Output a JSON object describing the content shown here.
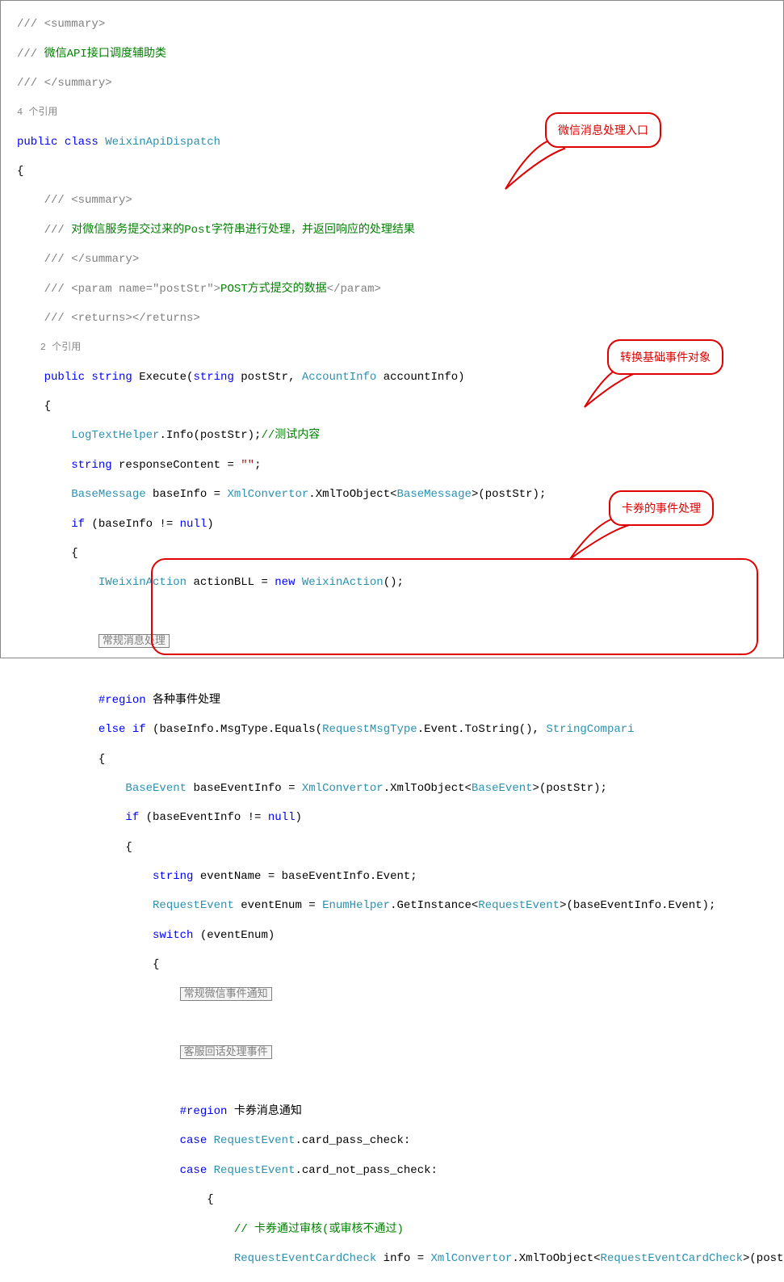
{
  "code": {
    "l01": "/// <summary>",
    "l02a": "/// ",
    "l02b": "微信API接口调度辅助类",
    "l03": "/// </summary>",
    "l04": "4 个引用",
    "l05a": "public",
    "l05b": " class",
    "l05c": " WeixinApiDispatch",
    "l06": "{",
    "l07": "    /// <summary>",
    "l08a": "    /// ",
    "l08b": "对微信服务提交过来的Post字符串进行处理，并返回响应的处理结果",
    "l09": "    /// </summary>",
    "l10a": "    /// <param name=\"postStr\">",
    "l10b": "POST方式提交的数据",
    "l10c": "</param>",
    "l11": "    /// <returns></returns>",
    "l12": "    2 个引用",
    "l13a": "    public",
    "l13b": " string",
    "l13c": " Execute(",
    "l13d": "string",
    "l13e": " postStr, ",
    "l13f": "AccountInfo",
    "l13g": " accountInfo)",
    "l14": "    {",
    "l15a": "        LogTextHelper",
    "l15b": ".Info(postStr);",
    "l15c": "//测试内容",
    "l16a": "        string",
    "l16b": " responseContent = ",
    "l16c": "\"\"",
    "l16d": ";",
    "l17a": "        BaseMessage",
    "l17b": " baseInfo = ",
    "l17c": "XmlConvertor",
    "l17d": ".XmlToObject<",
    "l17e": "BaseMessage",
    "l17f": ">(postStr);",
    "l18a": "        if",
    "l18b": " (baseInfo != ",
    "l18c": "null",
    "l18d": ")",
    "l19": "        {",
    "l20a": "            IWeixinAction",
    "l20b": " actionBLL = ",
    "l20c": "new",
    "l20d": " WeixinAction",
    "l20e": "();",
    "l21": " ",
    "l22a": "            ",
    "l22b": "常规消息处理",
    "l23": " ",
    "l24a": "            #region",
    "l24b": " 各种事件处理",
    "l25a": "            else",
    "l25b": " if",
    "l25c": " (baseInfo.MsgType.Equals(",
    "l25d": "RequestMsgType",
    "l25e": ".Event.ToString(), ",
    "l25f": "StringCompari",
    "l26": "            {",
    "l27a": "                BaseEvent",
    "l27b": " baseEventInfo = ",
    "l27c": "XmlConvertor",
    "l27d": ".XmlToObject<",
    "l27e": "BaseEvent",
    "l27f": ">(postStr);",
    "l28a": "                if",
    "l28b": " (baseEventInfo != ",
    "l28c": "null",
    "l28d": ")",
    "l29": "                {",
    "l30a": "                    string",
    "l30b": " eventName = baseEventInfo.Event;",
    "l31a": "                    RequestEvent",
    "l31b": " eventEnum = ",
    "l31c": "EnumHelper",
    "l31d": ".GetInstance<",
    "l31e": "RequestEvent",
    "l31f": ">(baseEventInfo.Event);",
    "l32a": "                    switch",
    "l32b": " (eventEnum)",
    "l33": "                    {",
    "l34a": "                        ",
    "l34b": "常规微信事件通知",
    "l35": " ",
    "l36a": "                        ",
    "l36b": "客服回话处理事件",
    "l37": " ",
    "l38a": "                        #region",
    "l38b": " 卡券消息通知",
    "l39a": "                        case",
    "l39b": " RequestEvent",
    "l39c": ".card_pass_check:",
    "l40a": "                        case",
    "l40b": " RequestEvent",
    "l40c": ".card_not_pass_check:",
    "l41": "                            {",
    "l42a": "                                ",
    "l42b": "// 卡券通过审核(或审核不通过)",
    "l43a": "                                RequestEventCardCheck",
    "l43b": " info = ",
    "l43c": "XmlConvertor",
    "l43d": ".XmlToObject<",
    "l43e": "RequestEventCardCheck",
    "l43f": ">(postStr);"
  },
  "callouts": {
    "c1": "微信消息处理入口",
    "c2": "转换基础事件对象",
    "c3": "卡券的事件处理"
  }
}
